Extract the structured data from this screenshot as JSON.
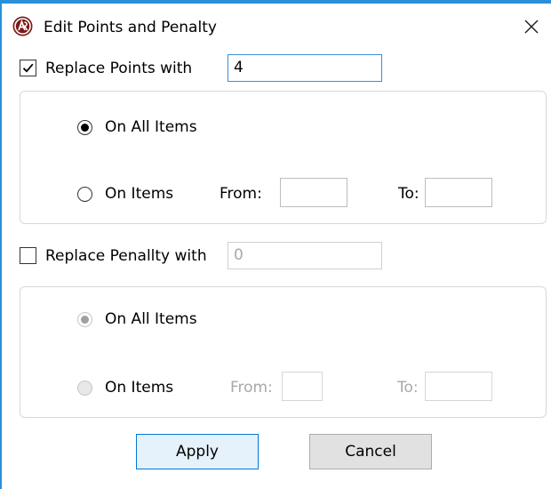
{
  "dialog": {
    "title": "Edit Points and Penalty",
    "close_glyph": "✕"
  },
  "points": {
    "checkbox_label": "Replace Points with",
    "checked": true,
    "value": "4",
    "scope": {
      "all_items_label": "On All Items",
      "on_items_label": "On Items",
      "from_label": "From:",
      "to_label": "To:",
      "selected": "all",
      "from_value": "",
      "to_value": ""
    }
  },
  "penalty": {
    "checkbox_label": "Replace Penallty with",
    "checked": false,
    "value": "0",
    "scope": {
      "all_items_label": "On All Items",
      "on_items_label": "On Items",
      "from_label": "From:",
      "to_label": "To:",
      "selected": "all",
      "from_value": "",
      "to_value": ""
    }
  },
  "buttons": {
    "apply_label": "Apply",
    "cancel_label": "Cancel"
  },
  "colors": {
    "window_border": "#2b8fd9",
    "focus_border": "#3a8fd8",
    "primary_button_bg": "#e5f1fb",
    "primary_button_border": "#0078d7",
    "disabled_text": "#a8a8a8"
  },
  "icons": {
    "app": "app-logo-icon",
    "close": "close-icon",
    "check": "checkmark-icon"
  }
}
